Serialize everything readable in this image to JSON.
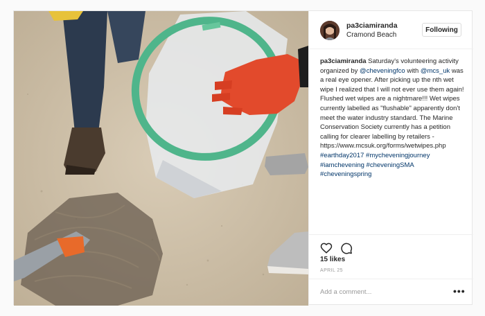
{
  "post": {
    "username": "pa3ciamiranda",
    "location": "Cramond Beach",
    "follow_label": "Following",
    "caption": {
      "p1": " Saturday's volunteering activity organized by ",
      "mention1": "@cheveningfco",
      "p2": " with ",
      "mention2": "@mcs_uk",
      "p3": " was a real eye opener. After picking up the nth wet wipe I realized that I will not ever use them again! Flushed wet wipes are a nightmare!!! Wet wipes currently labelled as \"flushable\" apparently don't meet the water industry standard. The Marine Conservation Society currently has a petition calling for clearer labelling by retailers - https://www.mcsuk.org/forms/wetwipes.php ",
      "tags": [
        "#earthday2017",
        "#mycheveningjourney",
        "#iamchevening",
        "#cheveningSMA",
        "#cheveningspring"
      ]
    },
    "likes": "15 likes",
    "date": "APRIL 25",
    "comment_placeholder": "Add a comment...",
    "more_label": "•••"
  },
  "icons": {
    "like": "heart-icon",
    "comment": "comment-icon"
  },
  "colors": {
    "text": "#262626",
    "link": "#003569",
    "muted": "#999999",
    "border": "#efefef"
  }
}
